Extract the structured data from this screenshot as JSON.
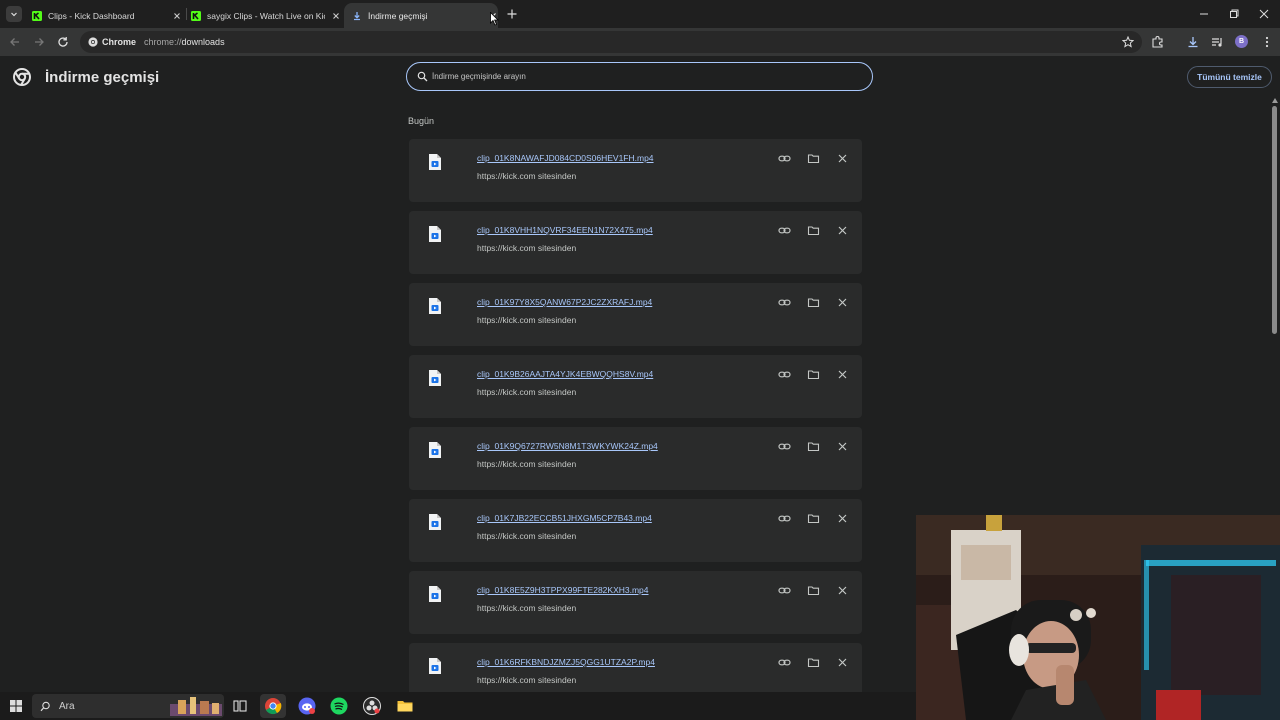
{
  "tabs": [
    {
      "title": "Clips - Kick Dashboard",
      "active": false
    },
    {
      "title": "saygix Clips - Watch Live on Kick",
      "active": false
    },
    {
      "title": "İndirme geçmişi",
      "active": true
    }
  ],
  "omnibox": {
    "chip": "Chrome",
    "scheme": "chrome://",
    "host": "downloads"
  },
  "profile": {
    "initial": "B"
  },
  "page": {
    "title": "İndirme geçmişi",
    "search_placeholder": "İndirme geçmişinde arayın",
    "clear_all_label": "Tümünü temizle",
    "date_group": "Bugün"
  },
  "downloads": [
    {
      "file": "clip_01K8NAWAFJD084CD0S06HEV1FH.mp4",
      "source": "https://kick.com sitesinden"
    },
    {
      "file": "clip_01K8VHH1NQVRF34EEN1N72X475.mp4",
      "source": "https://kick.com sitesinden"
    },
    {
      "file": "clip_01K97Y8X5QANW67P2JC2ZXRAFJ.mp4",
      "source": "https://kick.com sitesinden"
    },
    {
      "file": "clip_01K9B26AAJTA4YJK4EBWQQHS8V.mp4",
      "source": "https://kick.com sitesinden"
    },
    {
      "file": "clip_01K9Q6727RW5N8M1T3WKYWK24Z.mp4",
      "source": "https://kick.com sitesinden"
    },
    {
      "file": "clip_01K7JB22ECCB51JHXGM5CP7B43.mp4",
      "source": "https://kick.com sitesinden"
    },
    {
      "file": "clip_01K8E5Z9H3TPPX99FTE282KXH3.mp4",
      "source": "https://kick.com sitesinden"
    },
    {
      "file": "clip_01K6RFKBNDJZMZJ5QGG1UTZA2P.mp4",
      "source": "https://kick.com sitesinden"
    }
  ],
  "taskbar": {
    "search_label": "Ara",
    "apps": [
      "chrome-icon",
      "discord-icon",
      "spotify-icon",
      "obs-icon",
      "file-explorer-icon"
    ]
  },
  "colors": {
    "accent": "#a8c7fa",
    "kick_green": "#53fc18",
    "background": "#1f2020",
    "card": "#2a2b2b"
  }
}
